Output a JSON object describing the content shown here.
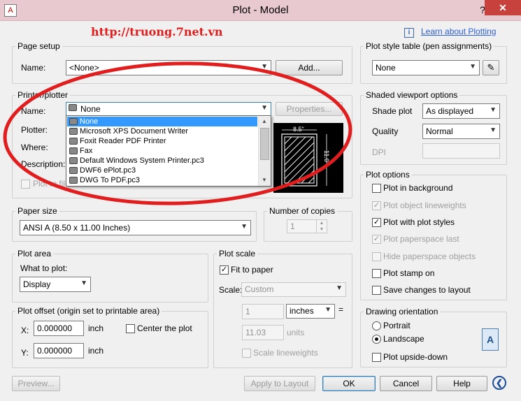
{
  "window": {
    "title": "Plot - Model",
    "help_label": "?",
    "close_label": "✕"
  },
  "watermark": "http://truong.7net.vn",
  "learn_link": "Learn about Plotting",
  "page_setup": {
    "title": "Page setup",
    "name_label": "Name:",
    "name_value": "<None>",
    "add_button": "Add..."
  },
  "printer": {
    "title": "Printer/plotter",
    "name_label": "Name:",
    "name_value": "None",
    "properties_button": "Properties...",
    "plotter_label": "Plotter:",
    "where_label": "Where:",
    "description_label": "Description:",
    "plot_to_file_label": "Plot to file",
    "options": [
      "None",
      "Microsoft XPS Document Writer",
      "Foxit Reader PDF Printer",
      "Fax",
      "Default Windows System Printer.pc3",
      "DWF6 ePlot.pc3",
      "DWG To PDF.pc3"
    ],
    "preview_width": "8.5\"",
    "preview_height": "11.0\""
  },
  "paper_size": {
    "title": "Paper size",
    "value": "ANSI A (8.50 x 11.00 Inches)"
  },
  "copies": {
    "title": "Number of copies",
    "value": "1"
  },
  "plot_area": {
    "title": "Plot area",
    "what_label": "What to plot:",
    "what_value": "Display"
  },
  "plot_offset": {
    "title": "Plot offset (origin set to printable area)",
    "x_label": "X:",
    "x_value": "0.000000",
    "y_label": "Y:",
    "y_value": "0.000000",
    "unit": "inch",
    "center_label": "Center the plot"
  },
  "plot_scale": {
    "title": "Plot scale",
    "fit_label": "Fit to paper",
    "scale_label": "Scale:",
    "scale_value": "Custom",
    "num_value": "1",
    "unit_value": "inches",
    "equals": "=",
    "units_value": "11.03",
    "units_label": "units",
    "lineweights_label": "Scale lineweights"
  },
  "plot_style": {
    "title": "Plot style table (pen assignments)",
    "value": "None"
  },
  "shaded": {
    "title": "Shaded viewport options",
    "shade_label": "Shade plot",
    "shade_value": "As displayed",
    "quality_label": "Quality",
    "quality_value": "Normal",
    "dpi_label": "DPI"
  },
  "plot_options": {
    "title": "Plot options",
    "items": [
      {
        "label": "Plot in background",
        "checked": false,
        "disabled": false
      },
      {
        "label": "Plot object lineweights",
        "checked": true,
        "disabled": true
      },
      {
        "label": "Plot with plot styles",
        "checked": true,
        "disabled": false
      },
      {
        "label": "Plot paperspace last",
        "checked": true,
        "disabled": true
      },
      {
        "label": "Hide paperspace objects",
        "checked": false,
        "disabled": true
      },
      {
        "label": "Plot stamp on",
        "checked": false,
        "disabled": false
      },
      {
        "label": "Save changes to layout",
        "checked": false,
        "disabled": false
      }
    ]
  },
  "orientation": {
    "title": "Drawing orientation",
    "portrait": "Portrait",
    "landscape": "Landscape",
    "upside_down": "Plot upside-down",
    "icon_letter": "A"
  },
  "footer": {
    "preview": "Preview...",
    "apply": "Apply to Layout",
    "ok": "OK",
    "cancel": "Cancel",
    "help": "Help"
  },
  "colors": {
    "annotation": "#e21d1d",
    "selection": "#3399ff",
    "close": "#c7413d"
  }
}
